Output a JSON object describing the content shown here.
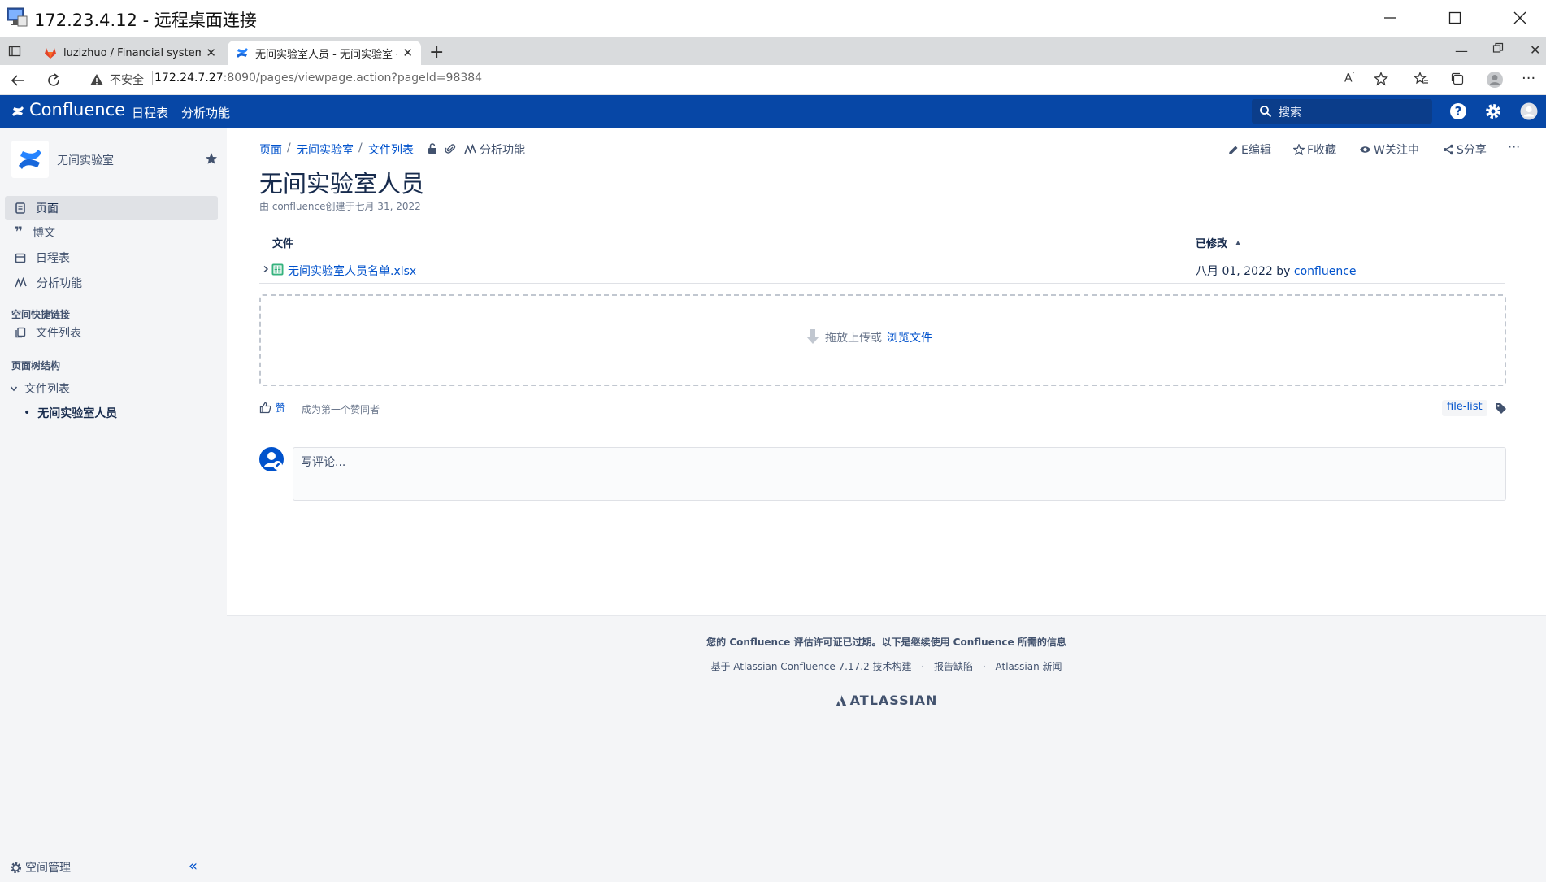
{
  "rdp": {
    "title": "172.23.4.12 - 远程桌面连接"
  },
  "browser": {
    "tabs": [
      {
        "label": "luzizhuo / Financial system-dem"
      },
      {
        "label": "无间实验室人员 - 无间实验室 - C"
      }
    ],
    "insecure_label": "不安全",
    "url_host": "172.24.7.27",
    "url_rest": ":8090/pages/viewpage.action?pageId=98384"
  },
  "header": {
    "logo": "Confluence",
    "nav": [
      "日程表",
      "分析功能"
    ],
    "search_placeholder": "搜索"
  },
  "sidebar": {
    "space_name": "无间实验室",
    "items": [
      {
        "label": "页面",
        "icon": "page-icon",
        "active": true
      },
      {
        "label": "博文",
        "icon": "quote-icon",
        "active": false
      },
      {
        "label": "日程表",
        "icon": "calendar-icon",
        "active": false
      },
      {
        "label": "分析功能",
        "icon": "analytics-icon",
        "active": false
      }
    ],
    "shortcuts_heading": "空间快捷链接",
    "shortcut": "文件列表",
    "tree_heading": "页面树结构",
    "tree_parent": "文件列表",
    "tree_child": "无间实验室人员",
    "space_admin": "空间管理"
  },
  "page": {
    "breadcrumbs": [
      "页面",
      "无间实验室",
      "文件列表"
    ],
    "analytics": "分析功能",
    "actions": {
      "edit": "E编辑",
      "save": "F收藏",
      "watch": "W关注中",
      "share": "S分享"
    },
    "title": "无间实验室人员",
    "byline": "由 confluence创建于七月 31, 2022"
  },
  "files": {
    "col_file": "文件",
    "col_modified": "已修改",
    "rows": [
      {
        "name": "无间实验室人员名单.xlsx",
        "modified_date": "八月 01, 2022",
        "by": "by",
        "author": "confluence"
      }
    ],
    "drop_text": "拖放上传或",
    "browse_link": "浏览文件"
  },
  "likes": {
    "like_label": "赞",
    "first_like": "成为第一个赞同者",
    "label_tag": "file-list"
  },
  "comment": {
    "placeholder": "写评论..."
  },
  "footer": {
    "license": "您的 Confluence 评估许可证已过期。以下是继续使用 Confluence 所需的信息",
    "powered": "基于 Atlassian Confluence 7.17.2 技术构建",
    "sep": "·",
    "report": "报告缺陷",
    "news": "Atlassian 新闻",
    "brand": "ATLASSIAN"
  },
  "colors": {
    "header_bg": "#0747a6",
    "link": "#0052cc",
    "sidebar_bg": "#f4f5f7"
  }
}
